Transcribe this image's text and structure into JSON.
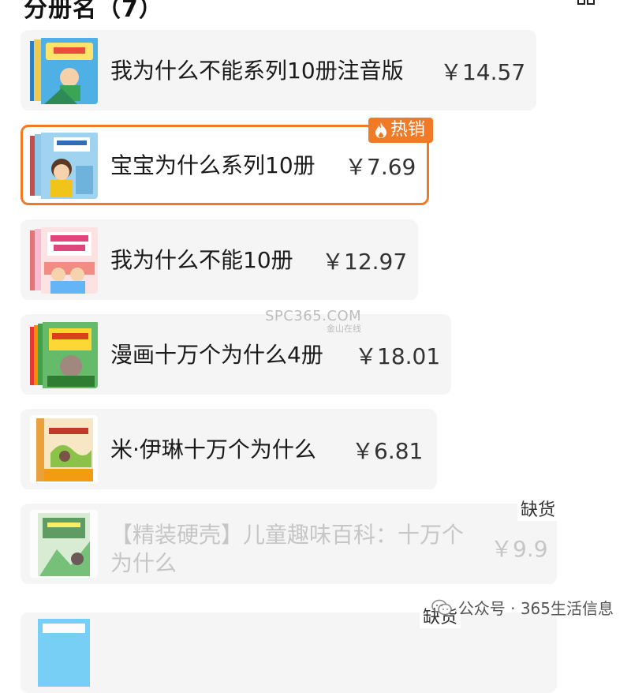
{
  "header": {
    "title": "分册名（7）"
  },
  "options": [
    {
      "name": "我为什么不能系列10册注音版",
      "price": "￥14.57"
    },
    {
      "name": "宝宝为什么系列10册",
      "price": "￥7.69",
      "badge": "热销"
    },
    {
      "name": "我为什么不能10册",
      "price": "￥12.97"
    },
    {
      "name": "漫画十万个为什么4册",
      "price": "￥18.01"
    },
    {
      "name": "米·伊琳十万个为什么",
      "price": "￥6.81"
    },
    {
      "name": "【精装硬壳】儿童趣味百科：十万个为什么",
      "price": "￥9.9",
      "status": "缺货"
    },
    {
      "name": "",
      "price": "",
      "status": "缺货"
    }
  ],
  "watermark": {
    "main": "SPC365.COM",
    "sub": "金山在线"
  },
  "footer": {
    "text": "公众号 · 365生活信息"
  },
  "colors": {
    "accent": "#f07a26",
    "card_bg": "#f5f5f5",
    "disabled_text": "#c6c6c6"
  },
  "icons": {
    "grid": "grid-icon",
    "fire": "fire-icon",
    "wechat": "wechat-icon"
  }
}
